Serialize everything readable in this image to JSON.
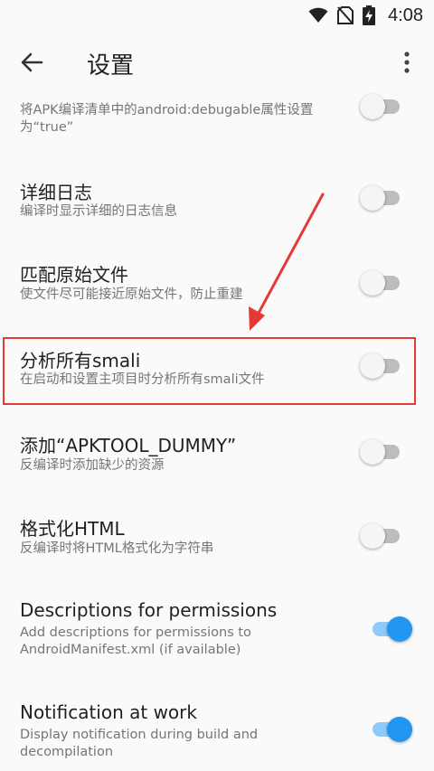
{
  "status_bar": {
    "time": "4:08",
    "icons": [
      "wifi-icon",
      "no-sim-icon",
      "battery-charging-icon"
    ]
  },
  "app_bar": {
    "title": "设置",
    "back_icon": "arrow-left-icon",
    "menu_icon": "more-vert-icon"
  },
  "settings": [
    {
      "id": "debuggable",
      "title": "",
      "summary": "将APK编译清单中的android:debugable属性设置为“true”",
      "enabled": false
    },
    {
      "id": "verbose-log",
      "title": "详细日志",
      "summary": "编译时显示详细的日志信息",
      "enabled": false
    },
    {
      "id": "match-original",
      "title": "匹配原始文件",
      "summary": "使文件尽可能接近原始文件，防止重建",
      "enabled": false
    },
    {
      "id": "analyze-smali",
      "title": "分析所有smali",
      "summary": "在启动和设置主项目时分析所有smali文件",
      "enabled": false,
      "highlighted": true
    },
    {
      "id": "apktool-dummy",
      "title": "添加“APKTOOL_DUMMY”",
      "summary": "反编译时添加缺少的资源",
      "enabled": false
    },
    {
      "id": "format-html",
      "title": "格式化HTML",
      "summary": "反编译时将HTML格式化为字符串",
      "enabled": false
    },
    {
      "id": "descriptions-permissions",
      "title": "Descriptions for permissions",
      "summary": "Add descriptions for permissions to AndroidManifest.xml (if available)",
      "enabled": true
    },
    {
      "id": "notification-work",
      "title": "Notification at work",
      "summary": "Display notification during build and decompilation",
      "enabled": true
    }
  ],
  "annotation": {
    "color": "#e53935"
  },
  "colors": {
    "accent": "#2196f3",
    "accent_track": "#90caf9"
  }
}
